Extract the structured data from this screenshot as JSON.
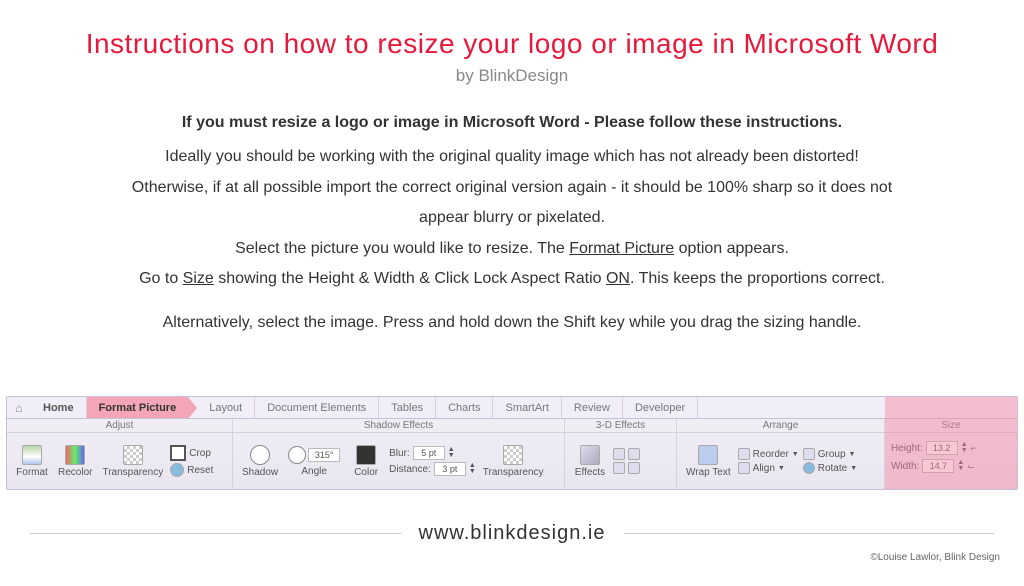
{
  "title": "Instructions on how to resize your logo or image in Microsoft Word",
  "byline": "by BlinkDesign",
  "body": {
    "lead": "If you must resize a logo or image in Microsoft Word - Please follow these instructions.",
    "p1": "Ideally you should be working with the original quality image which has not already been distorted!",
    "p2a": "Otherwise, if at all possible import the correct original version again - it should be 100% sharp so it does not",
    "p2b": "appear blurry or pixelated.",
    "p3a": "Select the picture you would like to resize. The ",
    "p3_u1": "Format Picture",
    "p3b": " option appears.",
    "p4a": "Go to ",
    "p4_u1": "Size",
    "p4b": " showing the Height & Width & Click Lock Aspect Ratio ",
    "p4_u2": "ON",
    "p4c": ". This keeps the proportions correct.",
    "p5": "Alternatively, select the image. Press and hold down the Shift key while you drag the sizing handle."
  },
  "tabs": {
    "home": "Home",
    "format_picture": "Format Picture",
    "layout": "Layout",
    "document_elements": "Document Elements",
    "tables": "Tables",
    "charts": "Charts",
    "smartart": "SmartArt",
    "review": "Review",
    "developer": "Developer"
  },
  "groups": {
    "adjust": {
      "label": "Adjust",
      "format": "Format",
      "recolor": "Recolor",
      "transparency": "Transparency",
      "crop": "Crop",
      "reset": "Reset"
    },
    "shadow": {
      "label": "Shadow Effects",
      "shadow": "Shadow",
      "angle": "Angle",
      "angle_value": "315°",
      "color": "Color",
      "blur_label": "Blur:",
      "blur_value": "5 pt",
      "distance_label": "Distance:",
      "distance_value": "3 pt",
      "transparency": "Transparency"
    },
    "threeD": {
      "label": "3-D Effects",
      "effects": "Effects"
    },
    "arrange": {
      "label": "Arrange",
      "wrap_text": "Wrap Text",
      "reorder": "Reorder",
      "align": "Align",
      "group": "Group",
      "rotate": "Rotate"
    },
    "size": {
      "label": "Size",
      "height_label": "Height:",
      "height_value": "13.2",
      "width_label": "Width:",
      "width_value": "14.7"
    }
  },
  "footer": {
    "site": "www.blinkdesign.ie",
    "credit": "©Louise Lawlor, Blink Design"
  }
}
